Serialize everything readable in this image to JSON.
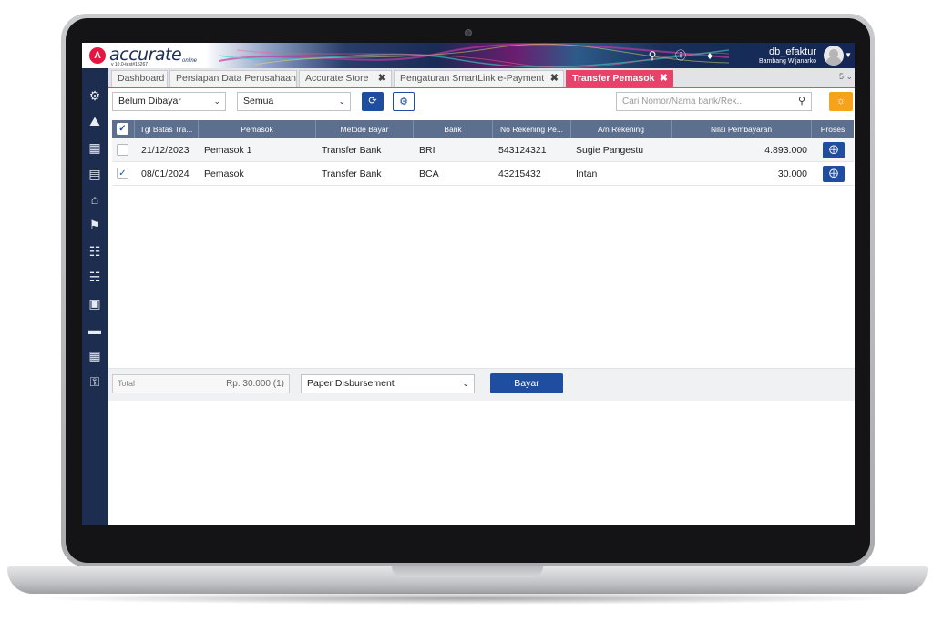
{
  "header": {
    "logo_text": "accurate",
    "logo_sub": "online",
    "version": "v 10.0-test#15267",
    "db_name": "db_efaktur",
    "user_name": "Bambang Wijanarko"
  },
  "tabs": [
    {
      "label": "Dashboard"
    },
    {
      "label": "Persiapan Data Perusahaan"
    },
    {
      "label": "Accurate Store",
      "close": "✖"
    },
    {
      "label": "Pengaturan SmartLink e-Payment",
      "close": "✖"
    },
    {
      "label": "Transfer Pemasok",
      "close": "✖",
      "active": true
    }
  ],
  "tab_count": "5 ⌄",
  "toolbar": {
    "status_filter": "Belum Dibayar",
    "type_filter": "Semua",
    "search_placeholder": "Cari Nomor/Nama bank/Rek..."
  },
  "table": {
    "columns": [
      "Tgl Batas Tra...",
      "Pemasok",
      "Metode Bayar",
      "Bank",
      "No Rekening Pe...",
      "A/n Rekening",
      "Nilai Pembayaran",
      "Proses"
    ],
    "rows": [
      {
        "checked": false,
        "date": "21/12/2023",
        "supplier": "Pemasok 1",
        "method": "Transfer Bank",
        "bank": "BRI",
        "account": "543124321",
        "account_name": "Sugie Pangestu",
        "amount": "4.893.000"
      },
      {
        "checked": true,
        "date": "08/01/2024",
        "supplier": "Pemasok",
        "method": "Transfer Bank",
        "bank": "BCA",
        "account": "43215432",
        "account_name": "Intan",
        "amount": "30.000"
      }
    ]
  },
  "footer": {
    "total_label": "Total",
    "total_value": "Rp. 30.000 (1)",
    "disbursement": "Paper Disbursement",
    "pay_label": "Bayar"
  },
  "colors": {
    "sidebar": "#1c2d4f",
    "accent_tab": "#e8416a",
    "primary_button": "#1f4ea0",
    "table_header": "#5d6f8e",
    "bulb_button": "#f7a21b"
  }
}
